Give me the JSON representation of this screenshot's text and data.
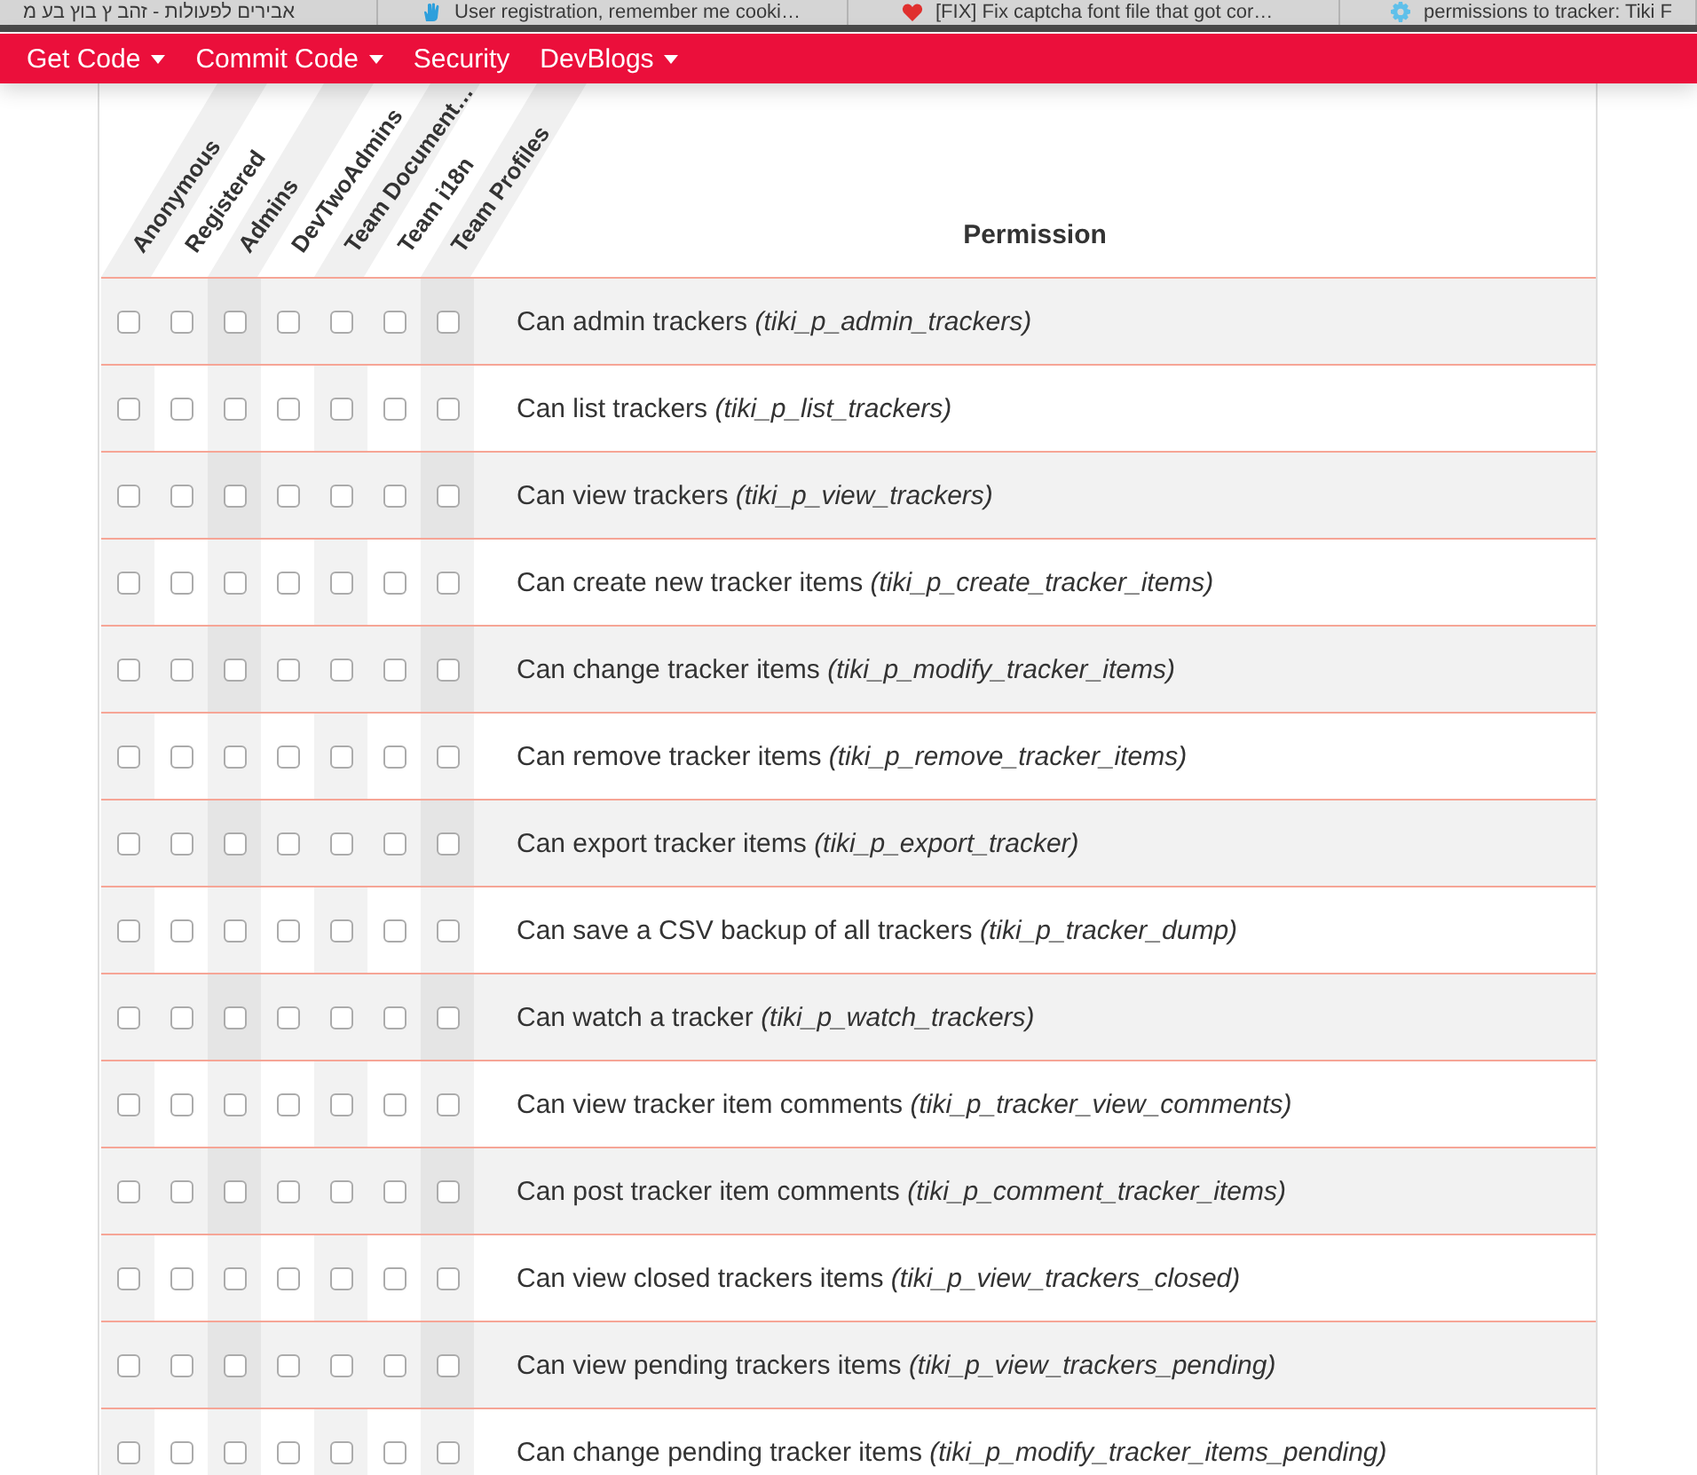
{
  "browser_tabs": [
    {
      "title": "אבירים לפעולות - זהב ץ בוץ בע מ"
    },
    {
      "title": "User registration, remember me cooki…"
    },
    {
      "title": "[FIX] Fix captcha font file that got cor…"
    },
    {
      "title": "permissions to tracker: Tiki F"
    }
  ],
  "navbar": {
    "items": [
      {
        "label": "Get Code",
        "dropdown": true
      },
      {
        "label": "Commit Code",
        "dropdown": true
      },
      {
        "label": "Security",
        "dropdown": false
      },
      {
        "label": "DevBlogs",
        "dropdown": true
      }
    ]
  },
  "permissions_table": {
    "groups": [
      "Anonymous",
      "Registered",
      "Admins",
      "DevTwoAdmins",
      "Team Document…",
      "Team i18n",
      "Team Profiles"
    ],
    "permission_heading": "Permission",
    "rows": [
      {
        "label": "Can admin trackers *(tiki_p_admin_trackers)*",
        "checks": [
          {
            "checked": false
          },
          {
            "checked": false
          },
          {
            "checked": false
          },
          {
            "checked": false
          },
          {
            "checked": false
          },
          {
            "checked": false
          },
          {
            "checked": false
          }
        ]
      },
      {
        "label": "Can list trackers *(tiki_p_list_trackers)*",
        "checks": [
          {
            "checked": false
          },
          {
            "checked": false
          },
          {
            "checked": false
          },
          {
            "checked": false
          },
          {
            "checked": false
          },
          {
            "checked": false
          },
          {
            "checked": false
          }
        ]
      },
      {
        "label": "Can view trackers *(tiki_p_view_trackers)*",
        "checks": [
          {
            "checked": false
          },
          {
            "checked": false
          },
          {
            "checked": false
          },
          {
            "checked": false
          },
          {
            "checked": false
          },
          {
            "checked": false
          },
          {
            "checked": false
          }
        ]
      },
      {
        "label": "Can create new tracker items *(tiki_p_create_tracker_items)*",
        "checks": [
          {
            "checked": false
          },
          {
            "checked": false
          },
          {
            "checked": false
          },
          {
            "checked": false
          },
          {
            "checked": false
          },
          {
            "checked": false
          },
          {
            "checked": false
          }
        ]
      },
      {
        "label": "Can change tracker items *(tiki_p_modify_tracker_items)*",
        "checks": [
          {
            "checked": false
          },
          {
            "checked": false
          },
          {
            "checked": false
          },
          {
            "checked": false
          },
          {
            "checked": false
          },
          {
            "checked": false
          },
          {
            "checked": false
          }
        ]
      },
      {
        "label": "Can remove tracker items *(tiki_p_remove_tracker_items)*",
        "checks": [
          {
            "checked": false
          },
          {
            "checked": false
          },
          {
            "checked": false
          },
          {
            "checked": false
          },
          {
            "checked": false
          },
          {
            "checked": false
          },
          {
            "checked": false
          }
        ]
      },
      {
        "label": "Can export tracker items *(tiki_p_export_tracker)*",
        "checks": [
          {
            "checked": false
          },
          {
            "checked": false
          },
          {
            "checked": false
          },
          {
            "checked": false
          },
          {
            "checked": false
          },
          {
            "checked": false
          },
          {
            "checked": false
          }
        ]
      },
      {
        "label": "Can save a CSV backup of all trackers *(tiki_p_tracker_dump)*",
        "checks": [
          {
            "checked": false
          },
          {
            "checked": false
          },
          {
            "checked": false
          },
          {
            "checked": false
          },
          {
            "checked": false
          },
          {
            "checked": false
          },
          {
            "checked": false
          }
        ]
      },
      {
        "label": "Can watch a tracker *(tiki_p_watch_trackers)*",
        "checks": [
          {
            "checked": false
          },
          {
            "checked": false
          },
          {
            "checked": false
          },
          {
            "checked": false
          },
          {
            "checked": false
          },
          {
            "checked": false
          },
          {
            "checked": false
          }
        ]
      },
      {
        "label": "Can view tracker item comments *(tiki_p_tracker_view_comments)*",
        "checks": [
          {
            "checked": false
          },
          {
            "checked": false
          },
          {
            "checked": false
          },
          {
            "checked": false
          },
          {
            "checked": false
          },
          {
            "checked": false
          },
          {
            "checked": false
          }
        ]
      },
      {
        "label": "Can post tracker item comments *(tiki_p_comment_tracker_items)*",
        "checks": [
          {
            "checked": false
          },
          {
            "checked": false
          },
          {
            "checked": false
          },
          {
            "checked": false
          },
          {
            "checked": false
          },
          {
            "checked": false
          },
          {
            "checked": false
          }
        ]
      },
      {
        "label": "Can view closed trackers items *(tiki_p_view_trackers_closed)*",
        "checks": [
          {
            "checked": false
          },
          {
            "checked": false
          },
          {
            "checked": false
          },
          {
            "checked": false
          },
          {
            "checked": false
          },
          {
            "checked": false
          },
          {
            "checked": false
          }
        ]
      },
      {
        "label": "Can view pending trackers items *(tiki_p_view_trackers_pending)*",
        "checks": [
          {
            "checked": false
          },
          {
            "checked": false
          },
          {
            "checked": false
          },
          {
            "checked": false
          },
          {
            "checked": false
          },
          {
            "checked": false
          },
          {
            "checked": false
          }
        ]
      },
      {
        "label": "Can change pending tracker items *(tiki_p_modify_tracker_items_pending)*",
        "checks": [
          {
            "checked": false
          },
          {
            "checked": false
          },
          {
            "checked": false
          },
          {
            "checked": false
          },
          {
            "checked": false
          },
          {
            "checked": false
          },
          {
            "checked": false
          }
        ]
      }
    ]
  }
}
